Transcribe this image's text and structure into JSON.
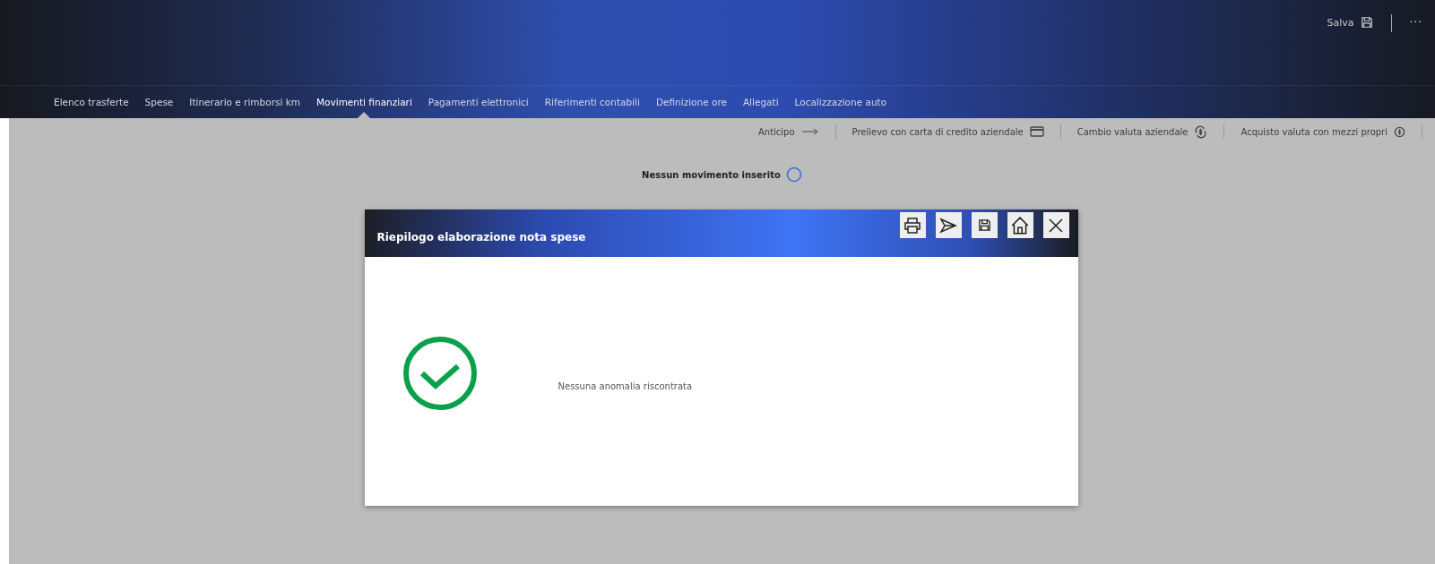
{
  "header": {
    "save_label": "Salva",
    "more": "···"
  },
  "tabs": [
    {
      "label": "Elenco trasferte",
      "selected": false
    },
    {
      "label": "Spese",
      "selected": false
    },
    {
      "label": "Itinerario e rimborsi km",
      "selected": false
    },
    {
      "label": "Movimenti finanziari",
      "selected": true
    },
    {
      "label": "Pagamenti elettronici",
      "selected": false
    },
    {
      "label": "Riferimenti contabili",
      "selected": false
    },
    {
      "label": "Definizione ore",
      "selected": false
    },
    {
      "label": "Allegati",
      "selected": false
    },
    {
      "label": "Localizzazione auto",
      "selected": false
    }
  ],
  "actions": [
    {
      "label": "Anticipo",
      "kind": "arrow"
    },
    {
      "label": "Prelievo con carta di credito aziendale",
      "kind": "card"
    },
    {
      "label": "Cambio valuta aziendale",
      "kind": "exchange"
    },
    {
      "label": "Acquisto valuta con mezzi propri",
      "kind": "coin"
    }
  ],
  "empty_message": "Nessun movimento inserito",
  "dialog": {
    "title": "Riepilogo elaborazione nota spese",
    "tools": [
      {
        "kind": "print"
      },
      {
        "kind": "send"
      },
      {
        "kind": "save"
      },
      {
        "kind": "home"
      },
      {
        "kind": "close"
      }
    ],
    "message": "Nessuna anomalia riscontrata"
  }
}
